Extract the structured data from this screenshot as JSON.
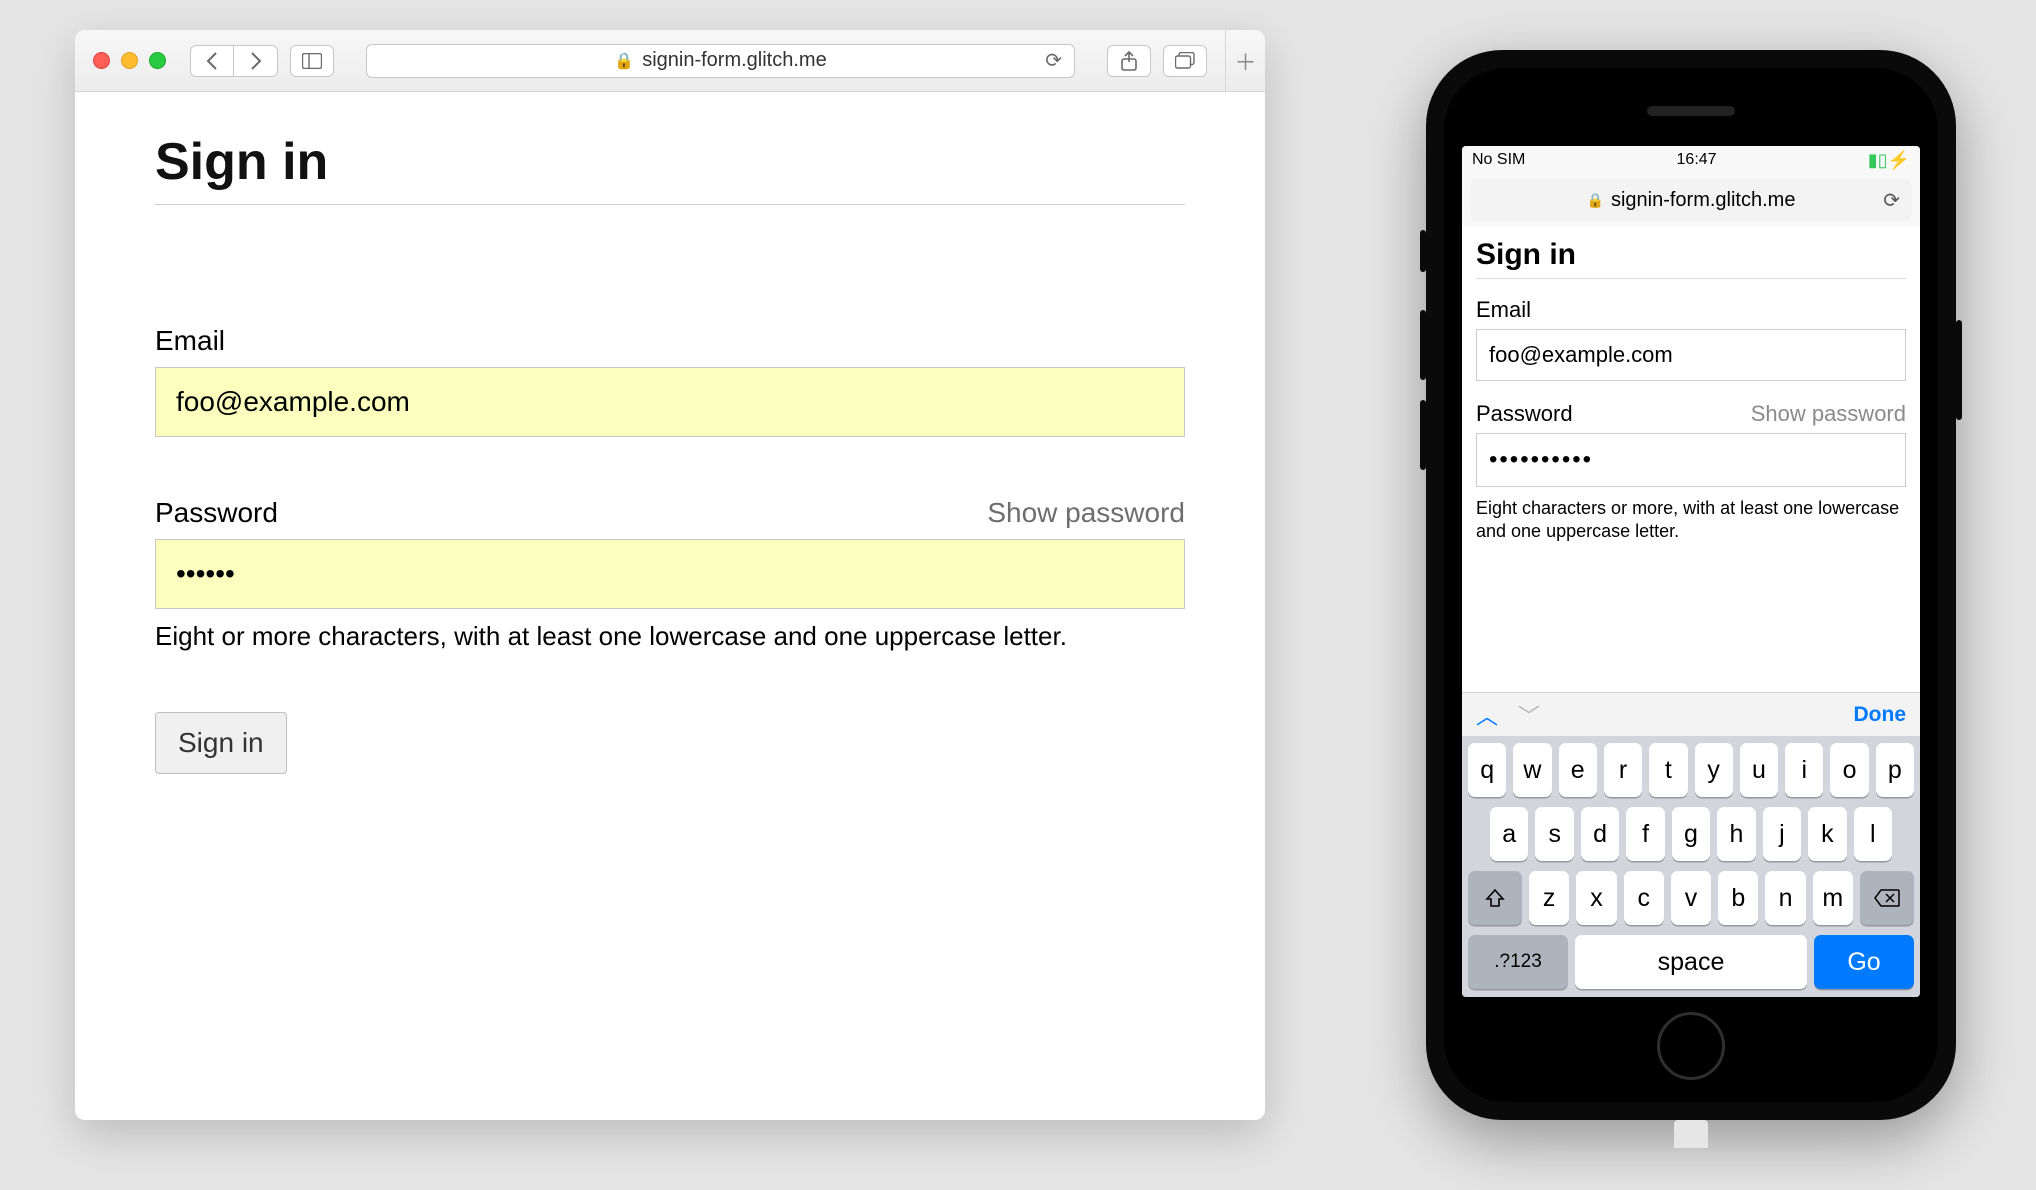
{
  "desktop": {
    "url": "signin-form.glitch.me",
    "page": {
      "title": "Sign in",
      "email_label": "Email",
      "email_value": "foo@example.com",
      "password_label": "Password",
      "show_password": "Show password",
      "password_masked": "••••••",
      "password_hint": "Eight or more characters, with at least one lowercase and one uppercase letter.",
      "submit": "Sign in"
    }
  },
  "mobile": {
    "status": {
      "carrier": "No SIM",
      "time": "16:47"
    },
    "url": "signin-form.glitch.me",
    "page": {
      "title": "Sign in",
      "email_label": "Email",
      "email_value": "foo@example.com",
      "password_label": "Password",
      "show_password": "Show password",
      "password_masked": "••••••••••",
      "password_hint": "Eight characters or more, with at least one lowercase and one uppercase letter."
    },
    "keyboard": {
      "done": "Done",
      "row1": [
        "q",
        "w",
        "e",
        "r",
        "t",
        "y",
        "u",
        "i",
        "o",
        "p"
      ],
      "row2": [
        "a",
        "s",
        "d",
        "f",
        "g",
        "h",
        "j",
        "k",
        "l"
      ],
      "row3": [
        "z",
        "x",
        "c",
        "v",
        "b",
        "n",
        "m"
      ],
      "numkey": ".?123",
      "space": "space",
      "go": "Go"
    }
  }
}
